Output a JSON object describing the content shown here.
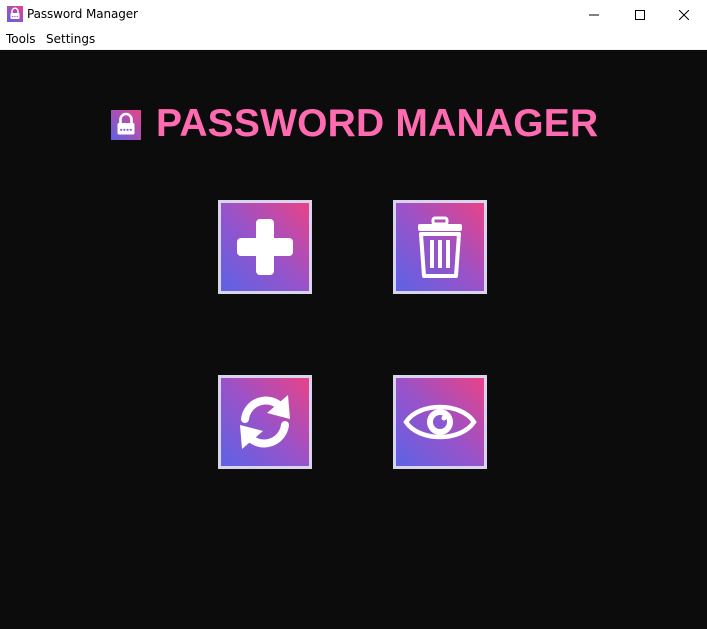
{
  "window": {
    "title": "Password Manager",
    "controls": [
      "minimize",
      "maximize",
      "close"
    ]
  },
  "menu": {
    "items": [
      {
        "label": "Tools"
      },
      {
        "label": "Settings"
      }
    ]
  },
  "header": {
    "title": "PASSWORD MANAGER",
    "icon": "padlock-icon"
  },
  "actions": [
    {
      "name": "add-password-button",
      "icon": "plus-icon"
    },
    {
      "name": "delete-password-button",
      "icon": "trash-icon"
    },
    {
      "name": "update-password-button",
      "icon": "refresh-icon"
    },
    {
      "name": "view-passwords-button",
      "icon": "eye-icon"
    }
  ],
  "colors": {
    "background": "#0c0c0c",
    "title": "#ff6bb0",
    "tile_gradient_start": "#5c63e6",
    "tile_gradient_end": "#e84388",
    "tile_border": "#d8d4ee"
  }
}
